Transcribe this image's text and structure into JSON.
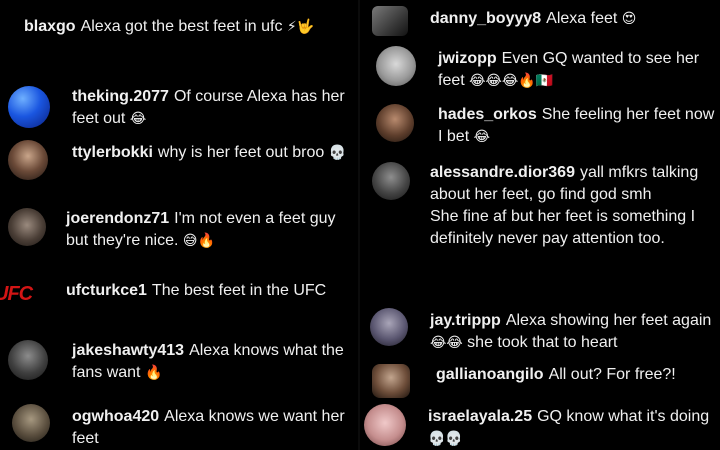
{
  "left_comments": [
    {
      "user": "blaxgo",
      "text": "Alexa got the best feet in ufc",
      "emoji": "⚡🤟"
    },
    {
      "user": "theking.2077",
      "text": "Of course Alexa has her feet out",
      "emoji": "😂"
    },
    {
      "user": "ttylerbokki",
      "text": "why is her feet out broo",
      "emoji": "💀"
    },
    {
      "user": "joerendonz71",
      "text": "I'm not even a feet guy but they're nice.",
      "emoji": "😅🔥"
    },
    {
      "user": "ufcturkce1",
      "text": "The best feet in the UFC",
      "emoji": "",
      "avatar_text": "UFC"
    },
    {
      "user": "jakeshawty413",
      "text": "Alexa knows what the fans want",
      "emoji": "🔥"
    },
    {
      "user": "ogwhoa420",
      "text": "Alexa knows we want her feet",
      "emoji": ""
    }
  ],
  "right_comments": [
    {
      "user": "danny_boyyy8",
      "text": "Alexa feet",
      "emoji": "😍"
    },
    {
      "user": "jwizopp",
      "text": "Even GQ wanted to see her feet",
      "emoji": "😂😂😂🔥🇲🇽"
    },
    {
      "user": "hades_orkos",
      "text": "She feeling her feet now I bet",
      "emoji": "😂"
    },
    {
      "user": "alessandre.dior369",
      "text": "yall mfkrs talking about her feet, go find god smh",
      "text2": "She fine af but her feet is something I definitely never pay attention too.",
      "emoji": ""
    },
    {
      "user": "jay.trippp",
      "text": "Alexa showing her feet again",
      "text_after": "she took that to heart",
      "emoji": "😂😂"
    },
    {
      "user": "gallianoangilo",
      "text": "All out? For free?!",
      "emoji": ""
    },
    {
      "user": "israelayala.25",
      "text": "GQ know what it's doing",
      "emoji": "💀💀"
    }
  ],
  "colors": {
    "background": "#000000",
    "text": "#f0f0f0",
    "ufc_red": "#d31515"
  }
}
